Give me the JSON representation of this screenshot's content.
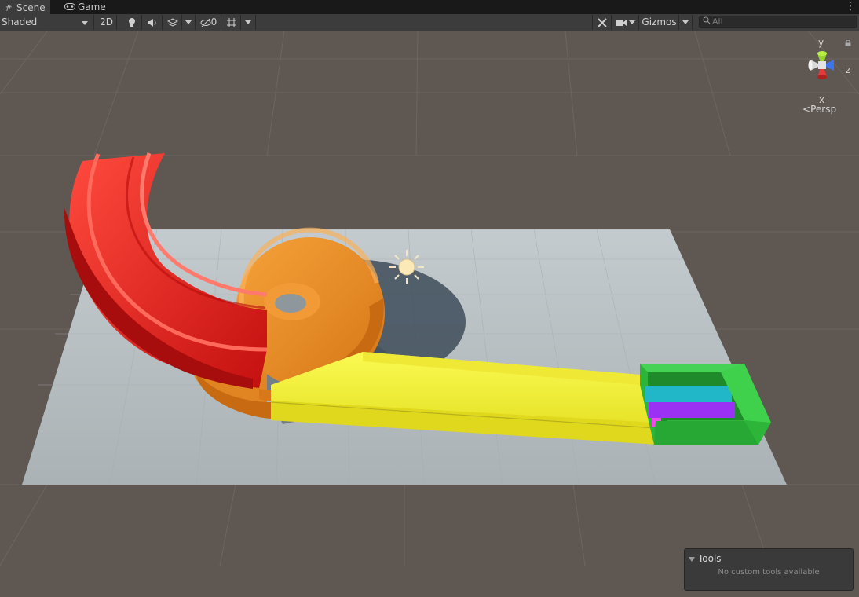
{
  "tabs": [
    {
      "label": "Scene",
      "icon": "grid-icon"
    },
    {
      "label": "Game",
      "icon": "gamepad-icon"
    }
  ],
  "toolbar": {
    "draw_mode": "Shaded",
    "mode_2d": "2D",
    "hidden_count": "0",
    "gizmos": "Gizmos",
    "search_placeholder": "All",
    "icons": [
      "lighting-icon",
      "audio-icon",
      "effects-icon",
      "visibility-icon",
      "grid-snap-icon",
      "tools-icon",
      "camera-icon"
    ]
  },
  "gizmo": {
    "y_label": "y",
    "z_label": "z",
    "x_label": "x",
    "projection": "Persp",
    "colors": {
      "x": "#e63a3a",
      "y": "#9ad32e",
      "z": "#3c76e8"
    }
  },
  "scene_objects": [
    {
      "name": "red-chute",
      "color": "#e8201f"
    },
    {
      "name": "orange-spiral",
      "color": "#f0922b"
    },
    {
      "name": "yellow-track",
      "color": "#f5f23b"
    },
    {
      "name": "green-box",
      "color": "#2fbe3a"
    },
    {
      "name": "ground-plane",
      "color": "#b8c0c4"
    },
    {
      "name": "directional-light",
      "icon": "sun-icon"
    }
  ],
  "tools_overlay": {
    "title": "Tools",
    "message": "No custom tools available"
  }
}
